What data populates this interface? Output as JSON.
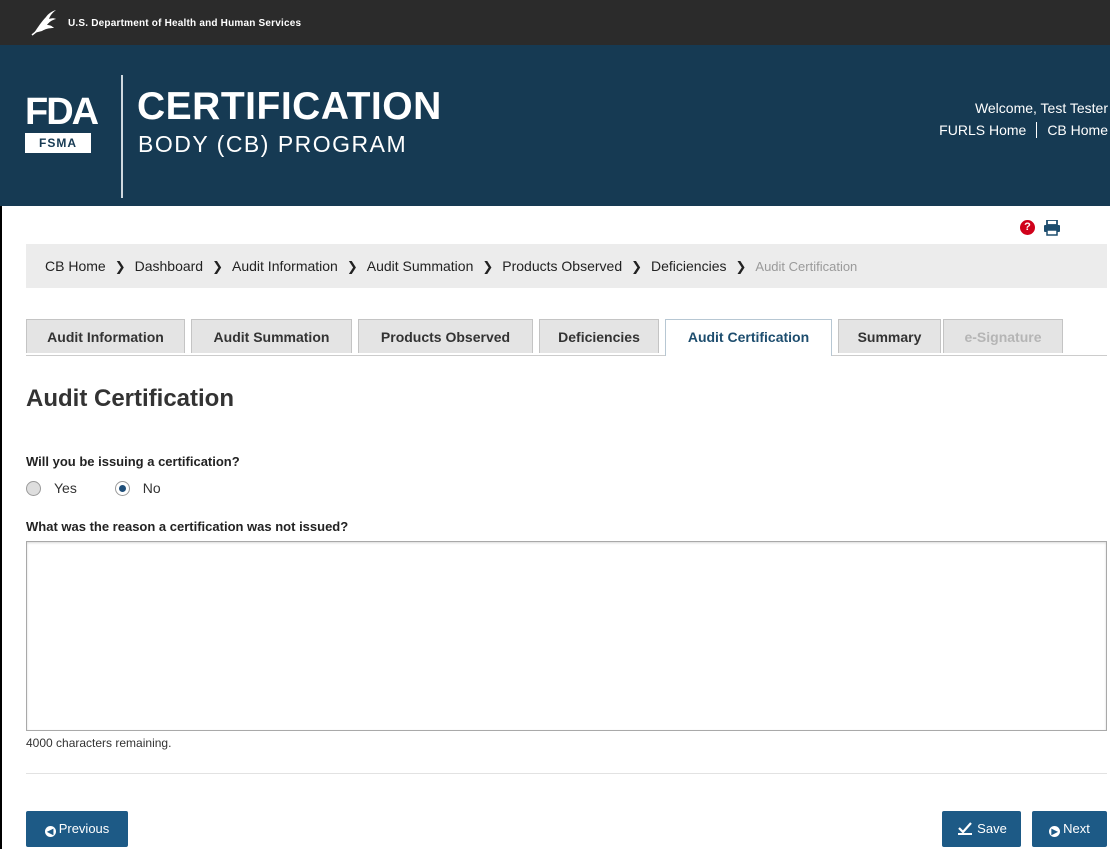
{
  "hhs_bar": {
    "text": "U.S. Department of Health and Human Services"
  },
  "banner": {
    "logo_top": "FDA",
    "logo_bottom": "FSMA",
    "title_line1": "CERTIFICATION",
    "title_line2": "BODY (CB) PROGRAM",
    "welcome": "Welcome, Test Tester",
    "links": [
      "FURLS Home",
      "CB Home"
    ]
  },
  "breadcrumb": {
    "items": [
      "CB Home",
      "Dashboard",
      "Audit Information",
      "Audit Summation",
      "Products Observed",
      "Deficiencies"
    ],
    "current": "Audit Certification"
  },
  "tabs": [
    {
      "label": "Audit Information",
      "state": "normal"
    },
    {
      "label": "Audit Summation",
      "state": "normal"
    },
    {
      "label": "Products Observed",
      "state": "normal"
    },
    {
      "label": "Deficiencies",
      "state": "normal"
    },
    {
      "label": "Audit Certification",
      "state": "active"
    },
    {
      "label": "Summary",
      "state": "normal"
    },
    {
      "label": "e-Signature",
      "state": "disabled"
    }
  ],
  "page_title": "Audit Certification",
  "form": {
    "question_issue": "Will you be issuing a certification?",
    "options": [
      "Yes",
      "No"
    ],
    "selected": "No",
    "question_reason": "What was the reason a certification was not issued?",
    "reason_value": "",
    "remaining_text": "4000 characters remaining."
  },
  "buttons": {
    "previous": "Previous",
    "save": "Save",
    "next": "Next"
  },
  "colors": {
    "banner": "#163a53",
    "button": "#1d5a86",
    "help": "#d0021b"
  }
}
